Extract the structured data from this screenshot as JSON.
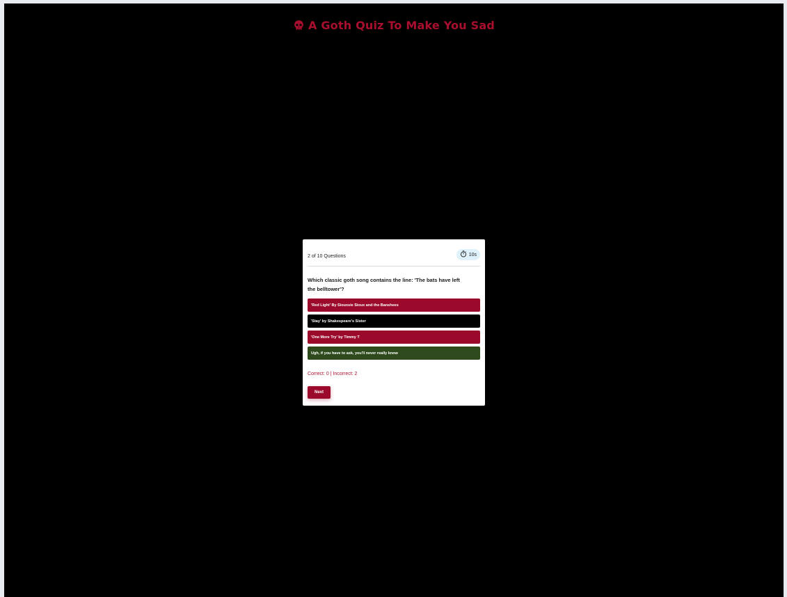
{
  "header": {
    "title": "A Goth Quiz To Make You Sad",
    "icon": "skull-icon",
    "title_color": "#a80f2e"
  },
  "quiz": {
    "progress_text": "2 of 10 Questions",
    "current_question": 2,
    "total_questions": 10,
    "timer": {
      "icon": "stopwatch-icon",
      "value": "10s"
    },
    "question": "Which classic goth song contains the line: 'The bats have left the belltower'?",
    "options": [
      {
        "label": "'Red Light' By Siouxsie Sioux and the Banshees",
        "color": "#9b0a2b"
      },
      {
        "label": "'Stay' by Shakespeare's Sister",
        "color": "#000000"
      },
      {
        "label": "'One More Try' by Timmy T",
        "color": "#9b0a2b"
      },
      {
        "label": "Ugh, if you have to ask, you'll never really know",
        "color": "#2e4a1d"
      }
    ],
    "score_text": "Correct: 0 | Incorrect: 2",
    "next_label": "Next"
  },
  "colors": {
    "background": "#000000",
    "accent": "#9b0a2b",
    "correct_answer": "#2e4a1d",
    "timer_bg": "#dff1fb"
  }
}
